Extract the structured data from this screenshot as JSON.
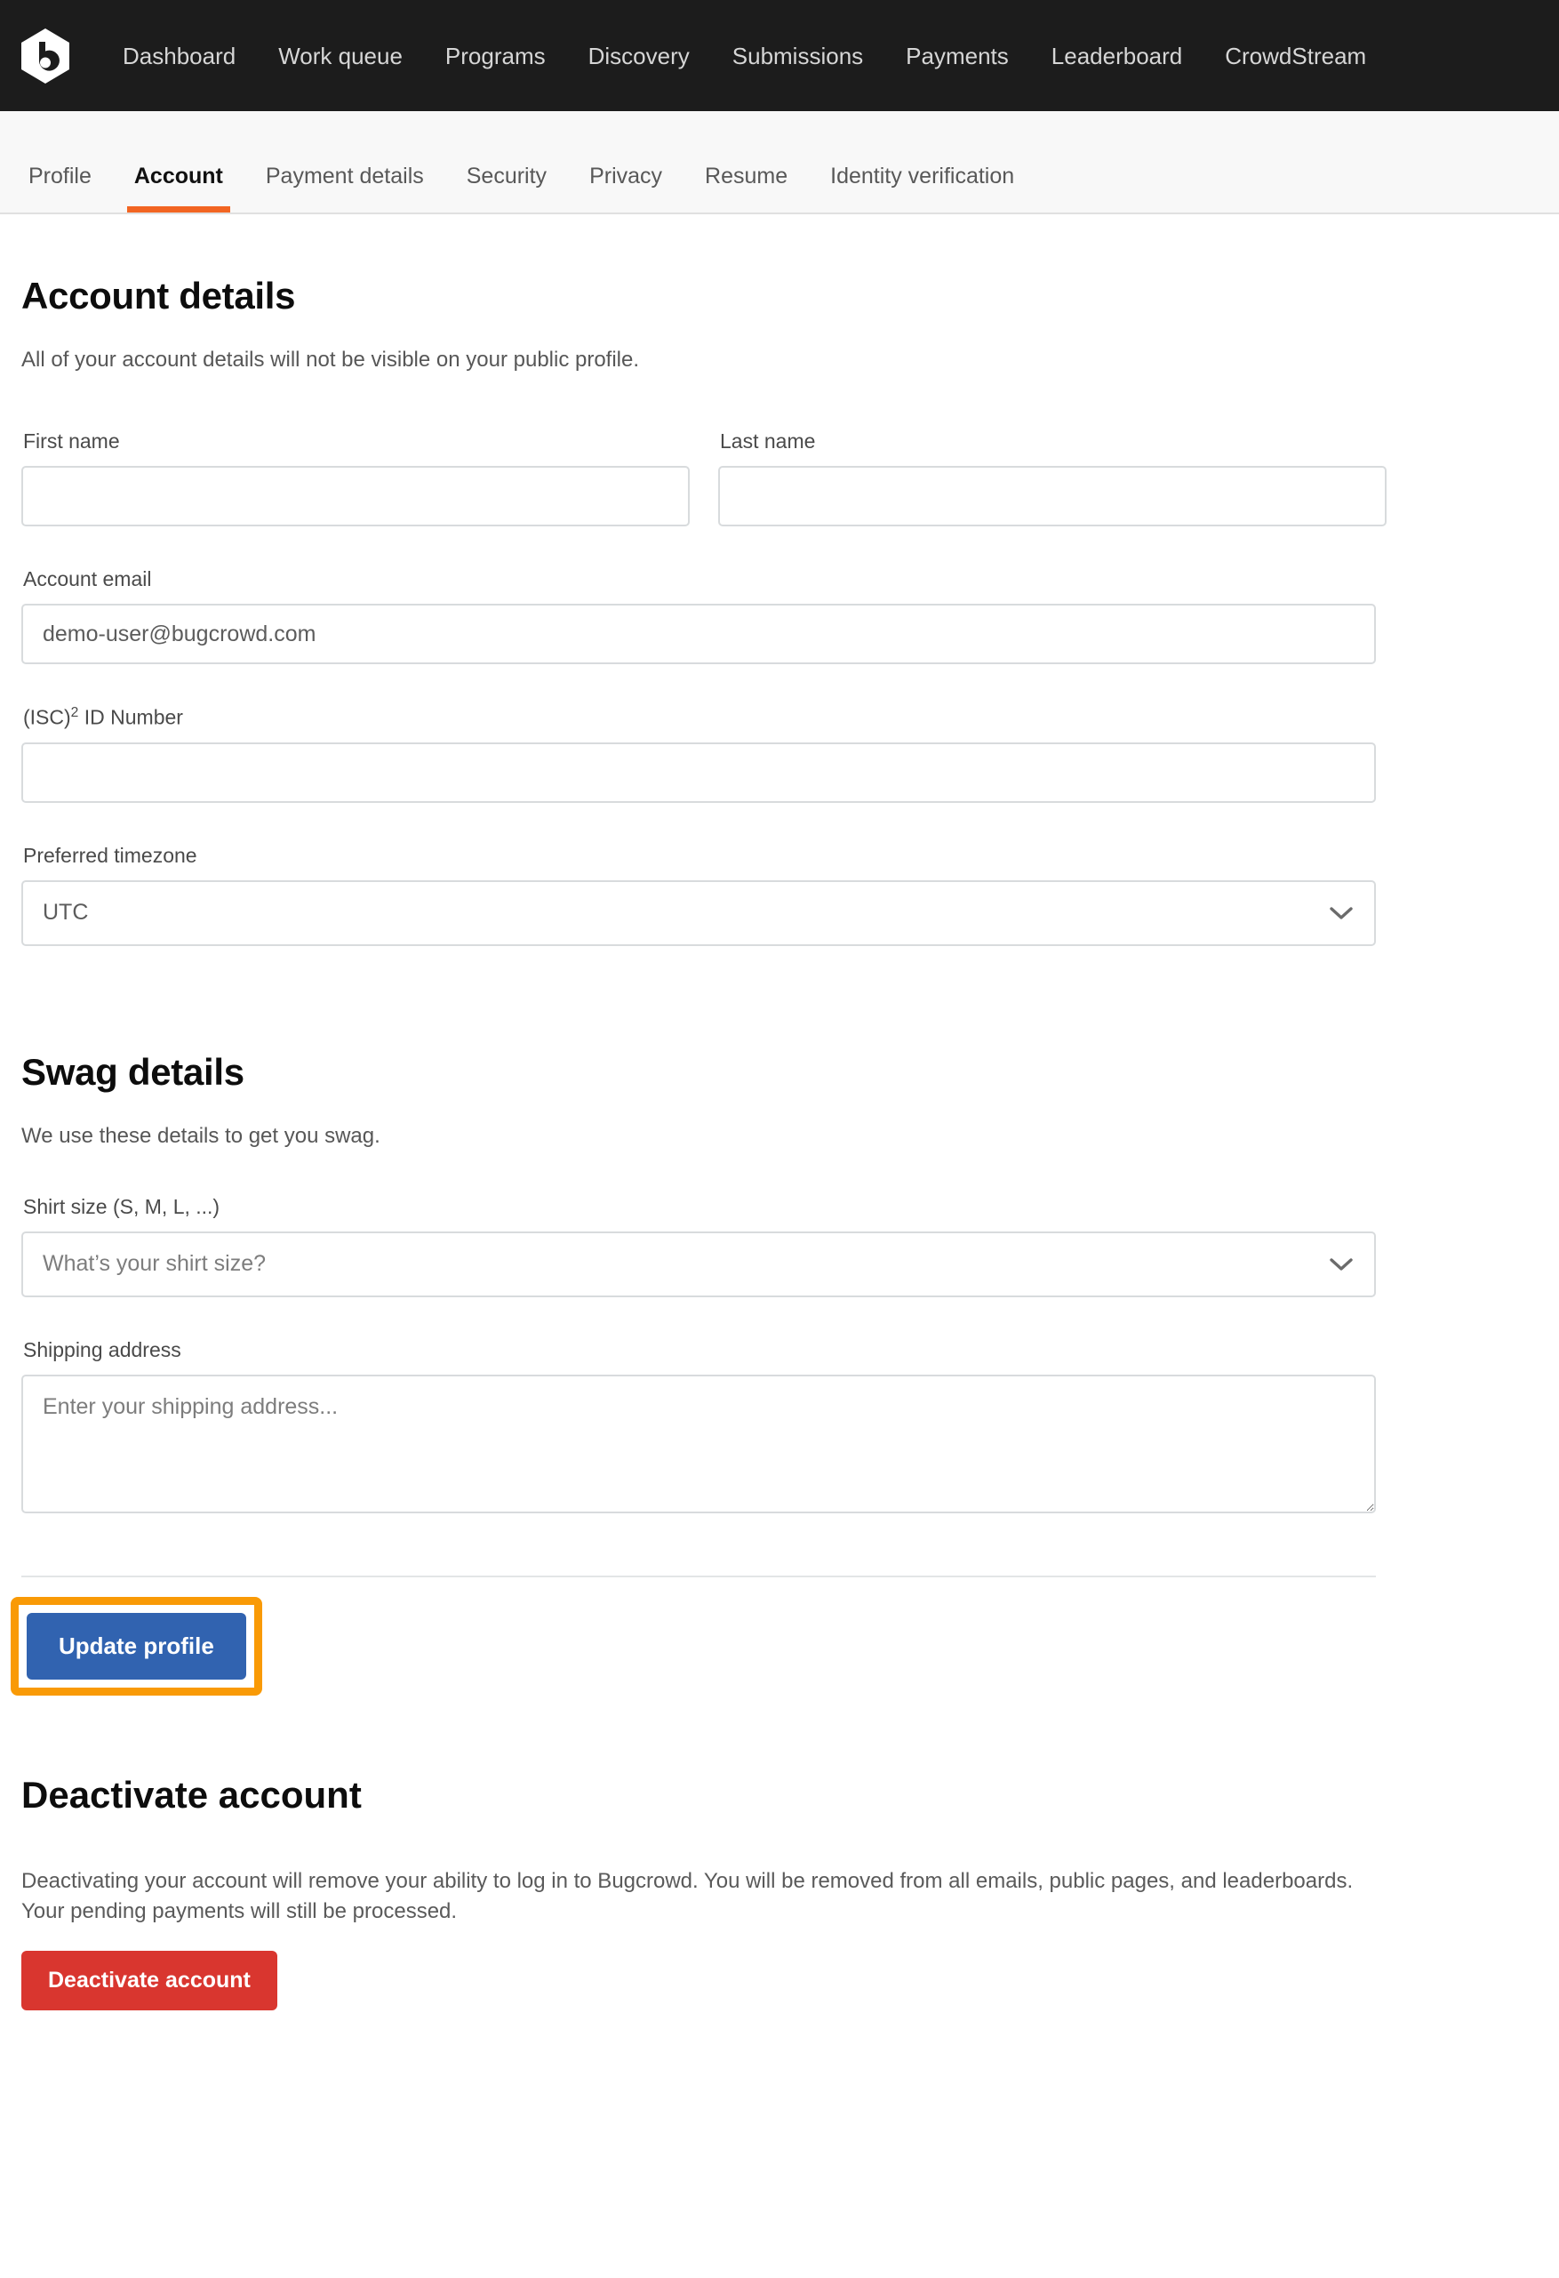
{
  "brand": {
    "logo_icon": "bugcrowd-hexagon-b-logo",
    "accent_orange": "#f26522",
    "primary_blue": "#3163b0",
    "danger_red": "#d9362f",
    "highlight_orange": "#f99a06",
    "topnav_bg": "#1c1c1c"
  },
  "topnav": {
    "links": [
      {
        "label": "Dashboard"
      },
      {
        "label": "Work queue"
      },
      {
        "label": "Programs"
      },
      {
        "label": "Discovery"
      },
      {
        "label": "Submissions"
      },
      {
        "label": "Payments"
      },
      {
        "label": "Leaderboard"
      },
      {
        "label": "CrowdStream"
      }
    ]
  },
  "tabs": [
    {
      "label": "Profile",
      "active": false
    },
    {
      "label": "Account",
      "active": true
    },
    {
      "label": "Payment details",
      "active": false
    },
    {
      "label": "Security",
      "active": false
    },
    {
      "label": "Privacy",
      "active": false
    },
    {
      "label": "Resume",
      "active": false
    },
    {
      "label": "Identity verification",
      "active": false
    }
  ],
  "account_details": {
    "title": "Account details",
    "subtitle": "All of your account details will not be visible on your public profile.",
    "first_name": {
      "label": "First name",
      "value": "",
      "placeholder": ""
    },
    "last_name": {
      "label": "Last name",
      "value": "",
      "placeholder": ""
    },
    "account_email": {
      "label": "Account email",
      "value": "demo-user@bugcrowd.com",
      "placeholder": ""
    },
    "isc_id": {
      "label_prefix": "(ISC)",
      "label_sup": "2",
      "label_suffix": " ID Number",
      "value": "",
      "placeholder": ""
    },
    "timezone": {
      "label": "Preferred timezone",
      "value": "UTC",
      "chevron_icon": "chevron-down-icon"
    }
  },
  "swag_details": {
    "title": "Swag details",
    "subtitle": "We use these details to get you swag.",
    "shirt_size": {
      "label": "Shirt size (S, M, L, ...)",
      "value": "",
      "placeholder": "What’s your shirt size?",
      "chevron_icon": "chevron-down-icon"
    },
    "shipping_address": {
      "label": "Shipping address",
      "value": "",
      "placeholder": "Enter your shipping address..."
    }
  },
  "actions": {
    "update_profile_label": "Update profile"
  },
  "deactivate": {
    "title": "Deactivate account",
    "text": "Deactivating your account will remove your ability to log in to Bugcrowd. You will be removed from all emails, public pages, and leaderboards. Your pending payments will still be processed.",
    "button_label": "Deactivate account"
  }
}
